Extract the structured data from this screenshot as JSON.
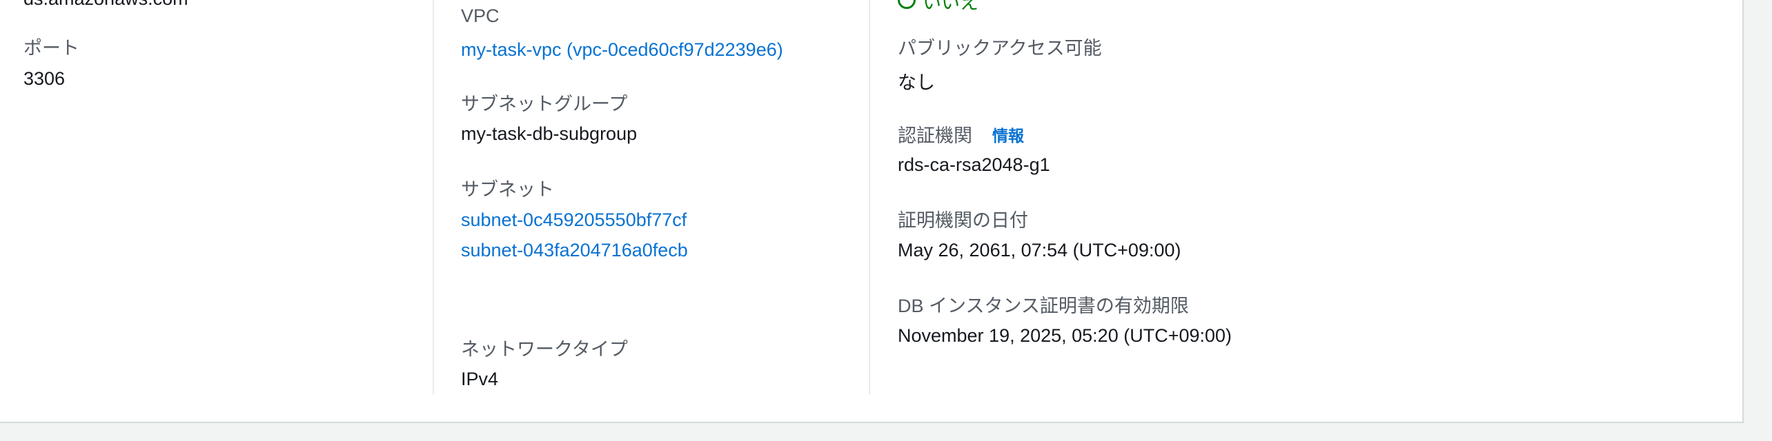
{
  "col1": {
    "endpoint_partial": "ds.amazonaws.com",
    "port_label": "ポート",
    "port_value": "3306"
  },
  "col2": {
    "vpc_label": "VPC",
    "vpc_value": "my-task-vpc (vpc-0ced60cf97d2239e6)",
    "subnet_group_label": "サブネットグループ",
    "subnet_group_value": "my-task-db-subgroup",
    "subnets_label": "サブネット",
    "subnets": [
      "subnet-0c459205550bf77cf",
      "subnet-043fa204716a0fecb"
    ],
    "network_type_label": "ネットワークタイプ",
    "network_type_value": "IPv4"
  },
  "col3": {
    "status_partial": "いいえ",
    "public_access_label": "パブリックアクセス可能",
    "public_access_value": "なし",
    "ca_label": "認証機関",
    "ca_info": "情報",
    "ca_value": "rds-ca-rsa2048-g1",
    "ca_date_label": "証明機関の日付",
    "ca_date_value": "May 26, 2061, 07:54 (UTC+09:00)",
    "cert_expiry_label": "DB インスタンス証明書の有効期限",
    "cert_expiry_value": "November 19, 2025, 05:20 (UTC+09:00)"
  },
  "colors": {
    "link": "#0972d3",
    "label": "#545b64",
    "text": "#16191f",
    "success": "#037f0c"
  }
}
